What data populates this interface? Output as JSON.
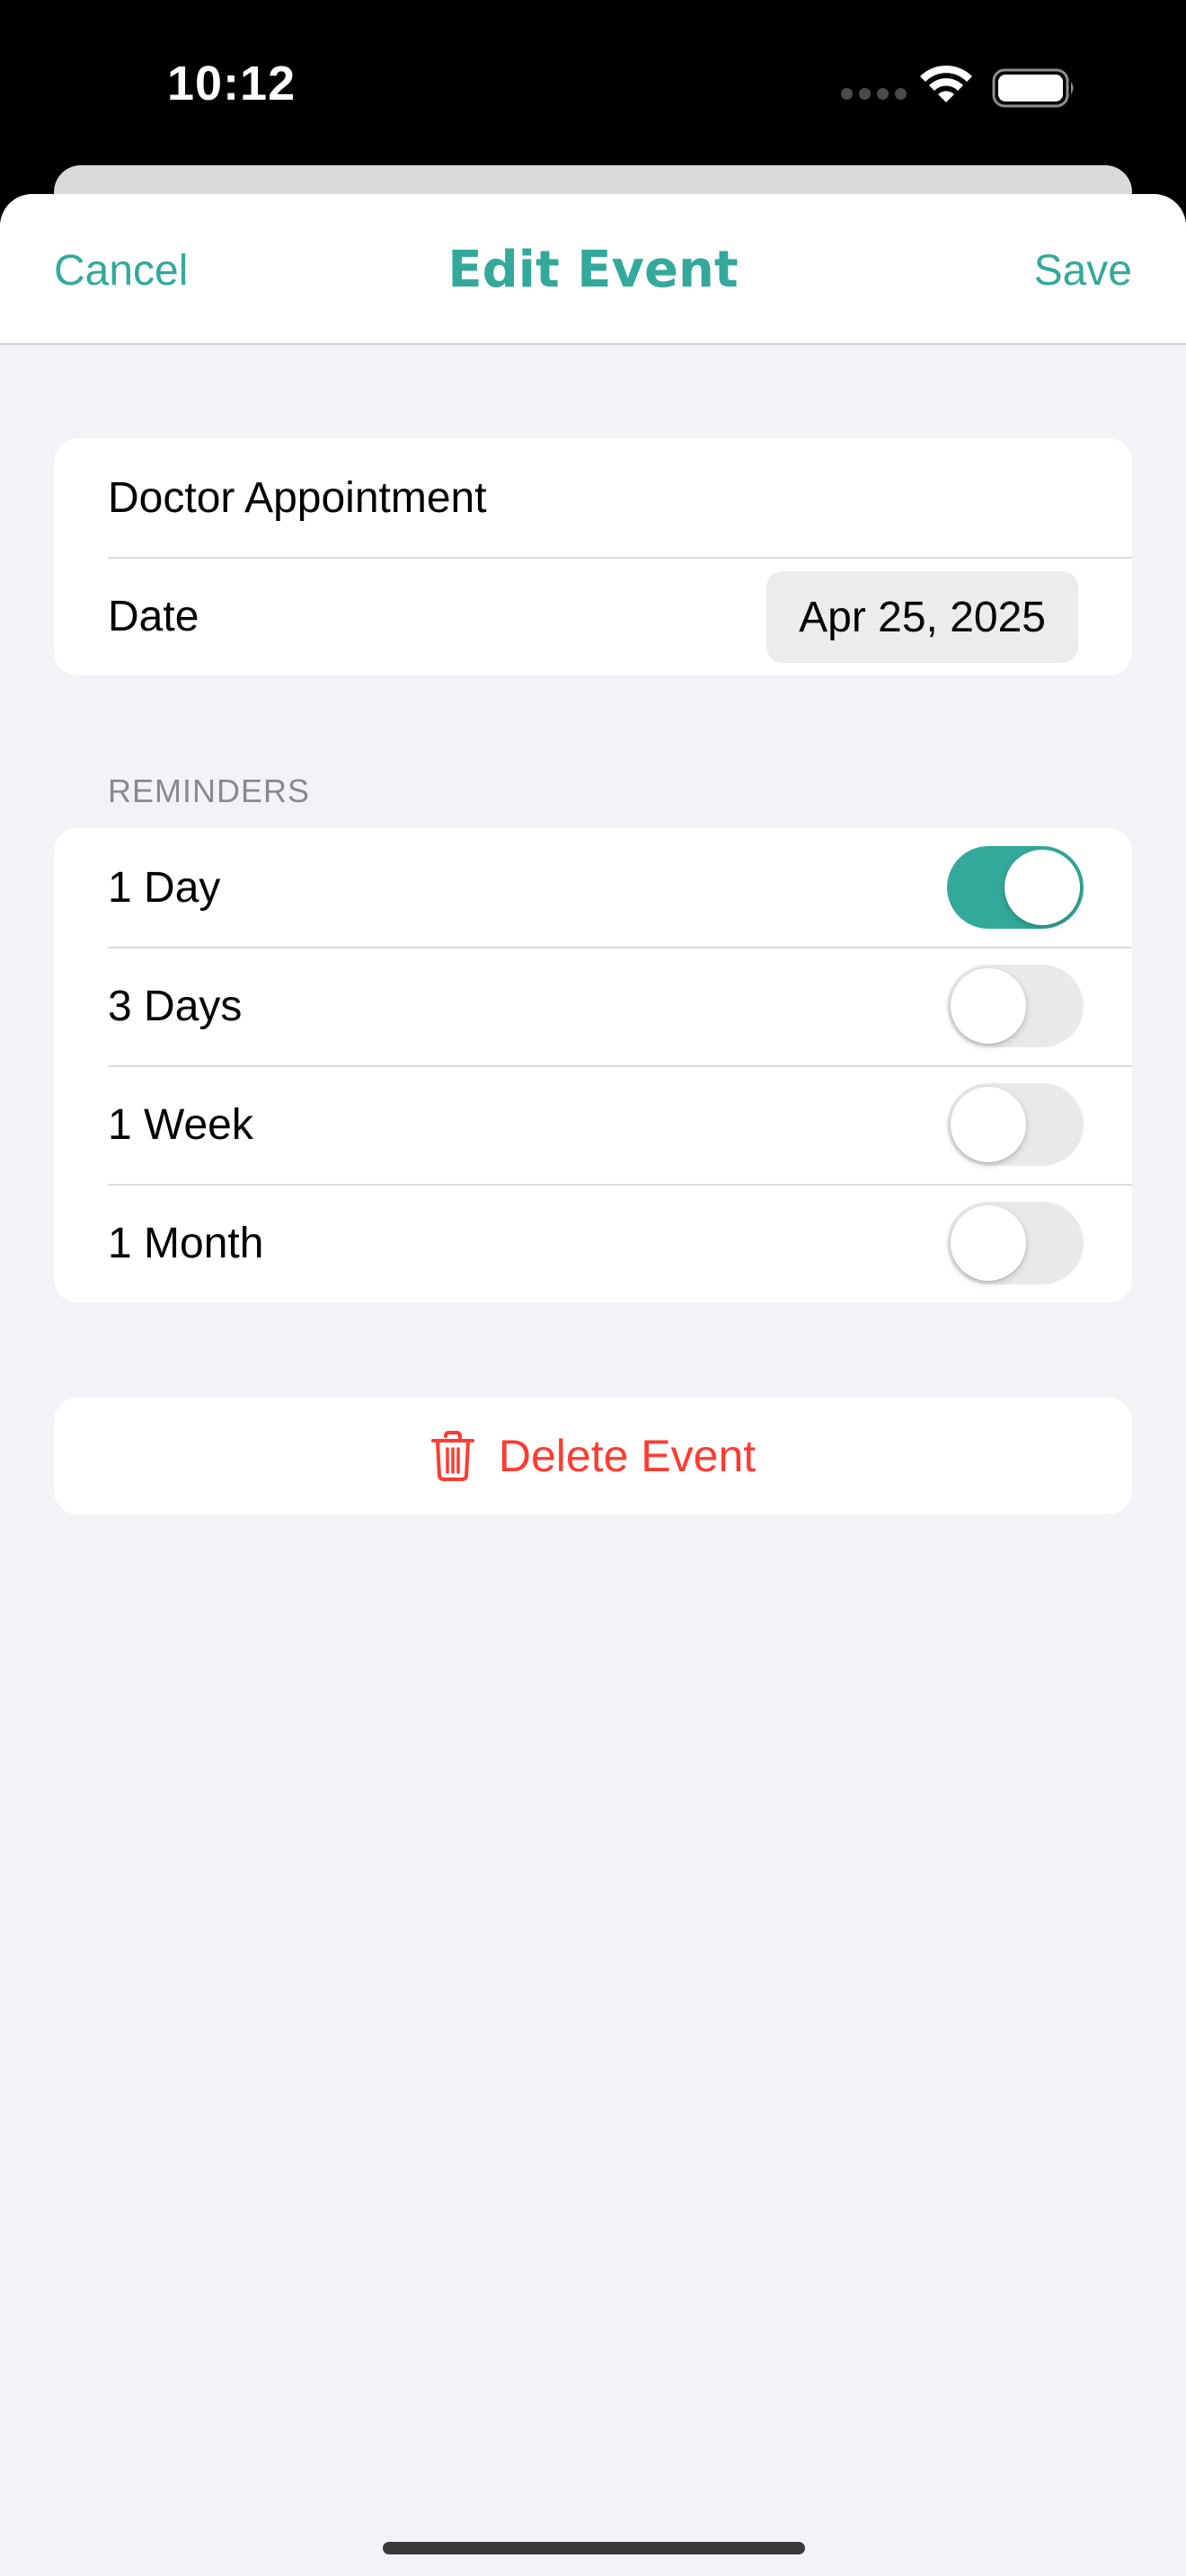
{
  "status_bar": {
    "time": "10:12",
    "signal_icon": "cellular-signal-icon",
    "wifi_icon": "wifi-icon",
    "battery_icon": "battery-icon"
  },
  "nav": {
    "cancel_label": "Cancel",
    "title": "Edit Event",
    "save_label": "Save",
    "accent_color": "#33a99c"
  },
  "event": {
    "title_value": "Doctor Appointment",
    "date_label": "Date",
    "date_value": "Apr 25, 2025"
  },
  "reminders": {
    "header": "REMINDERS",
    "items": [
      {
        "label": "1 Day",
        "enabled": true
      },
      {
        "label": "3 Days",
        "enabled": false
      },
      {
        "label": "1 Week",
        "enabled": false
      },
      {
        "label": "1 Month",
        "enabled": false
      }
    ]
  },
  "delete": {
    "label": "Delete Event",
    "icon": "trash-icon",
    "color": "#ff3b30"
  }
}
